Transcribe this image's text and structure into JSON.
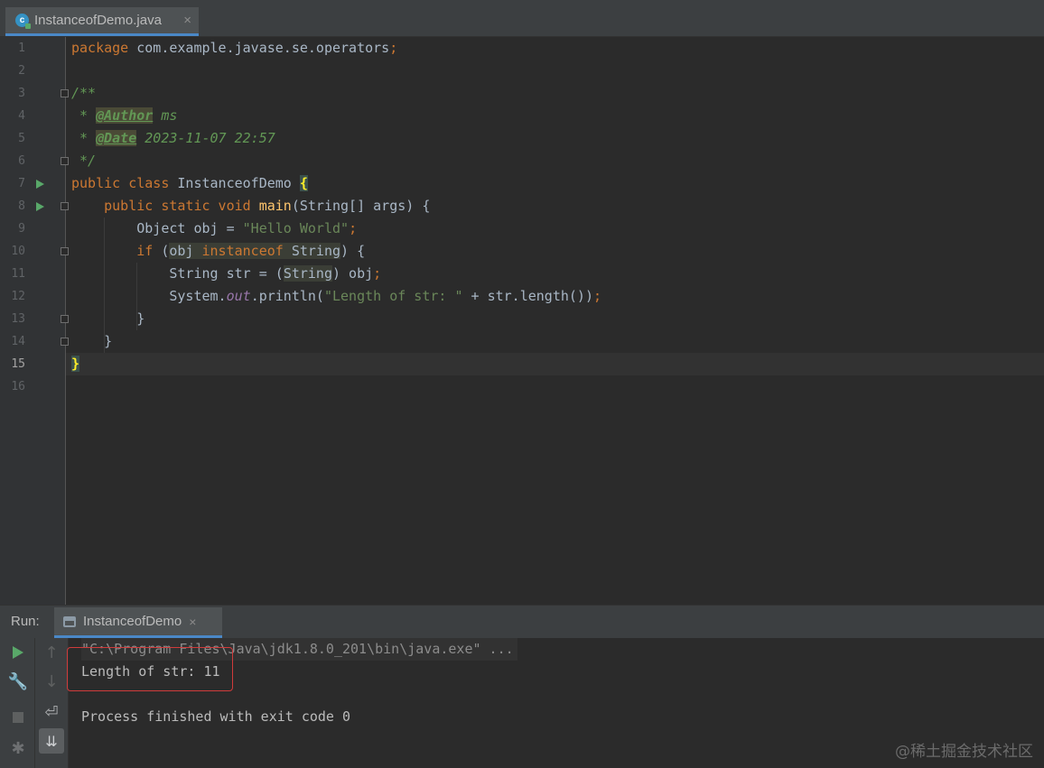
{
  "editor_tab": {
    "filename": "InstanceofDemo.java",
    "icon": "java-class-icon",
    "close": "×"
  },
  "line_numbers": [
    "1",
    "2",
    "3",
    "4",
    "5",
    "6",
    "7",
    "8",
    "9",
    "10",
    "11",
    "12",
    "13",
    "14",
    "15",
    "16"
  ],
  "code": {
    "l1_kw": "package",
    "l1_rest": " com.example.javase.se.operators",
    "l1_semi": ";",
    "l3": "/**",
    "l4_star": " * ",
    "l4_tag": "@Author",
    "l4_val": " ms",
    "l5_star": " * ",
    "l5_tag": "@Date",
    "l5_val": " 2023-11-07 22:57",
    "l6": " */",
    "l7_kw": "public class",
    "l7_name": " InstanceofDemo ",
    "l7_brace": "{",
    "l8_indent": "    ",
    "l8_kw": "public static void",
    "l8_fn": "main",
    "l8_rest": "(String[] args) {",
    "l9_indent": "        ",
    "l9_rest": "Object obj = ",
    "l9_str": "\"Hello World\"",
    "l9_semi": ";",
    "l10_indent": "        ",
    "l10_kw": "if",
    "l10_open": " (",
    "l10_obj": "obj",
    "l10_instanceof": "instanceof",
    "l10_type": "String",
    "l10_close": ") {",
    "l11_indent": "            ",
    "l11_rest": "String str = (",
    "l11_type": "String",
    "l11_end": ") obj",
    "l11_semi": ";",
    "l12_indent": "            ",
    "l12_sys": "System.",
    "l12_out": "out",
    "l12_print": ".println(",
    "l12_str": "\"Length of str: \"",
    "l12_rest": " + str.length())",
    "l12_semi": ";",
    "l13": "        }",
    "l14": "    }",
    "l15_brace": "}"
  },
  "run_panel": {
    "label": "Run:",
    "tab_name": "InstanceofDemo",
    "tab_close": "×",
    "console": {
      "command": "\"C:\\Program Files\\Java\\jdk1.8.0_201\\bin\\java.exe\" ...",
      "output": "Length of str: 11",
      "exit": "Process finished with exit code 0"
    }
  },
  "watermark": "@稀土掘金技术社区",
  "colors": {
    "keyword": "#cc7832",
    "string": "#6a8759",
    "doc": "#629755",
    "function": "#ffc66d",
    "annotation_box": "#d03b3b"
  }
}
